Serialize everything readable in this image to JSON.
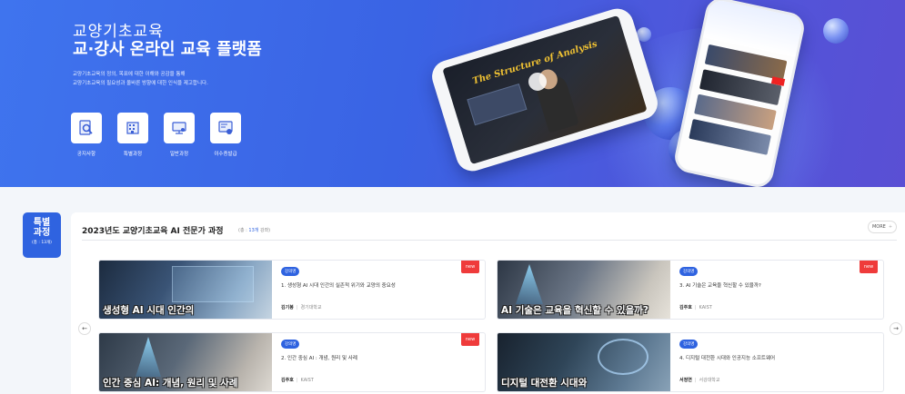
{
  "hero": {
    "title_line1": "교양기초교육",
    "title_line2": "교·강사 온라인 교육 플랫폼",
    "desc_line1": "교양기초교육의 정의, 목표에 대한 이해와 공감을 통해",
    "desc_line2": "교양기초교육의 필요성과 올바른 방향에 대한 인식을 제고합니다.",
    "tablet_screen_title": "The Structure of Analysis",
    "quick_menu": [
      {
        "label": "공지사항",
        "icon": "magnifier-document-icon"
      },
      {
        "label": "특별과정",
        "icon": "building-icon"
      },
      {
        "label": "일반과정",
        "icon": "monitor-person-icon"
      },
      {
        "label": "이수증발급",
        "icon": "certificate-icon"
      }
    ]
  },
  "section": {
    "side_badge_line1": "특별",
    "side_badge_line2": "과정",
    "side_badge_count": "(총 : 13개)",
    "title": "2023년도 교양기초교육 AI 전문가 과정",
    "subtitle_prefix": "(총 : ",
    "subtitle_count": "13개",
    "subtitle_suffix": " 강좌)",
    "more_label": "MORE",
    "more_icon": "plus-icon",
    "prev_icon": "arrow-left-icon",
    "next_icon": "arrow-right-icon"
  },
  "courses": [
    {
      "tag": "강의명",
      "title": "1. 생성형 AI 시대 인간의 실존적 위기와 교양의 중요성",
      "author": "김기봉",
      "affiliation": "경기대학교",
      "thumb_label": "생성형 AI 시대 인간의",
      "is_new": true,
      "new_label": "new"
    },
    {
      "tag": "강의명",
      "title": "3. AI 기술은 교육을 혁신할 수 있을까?",
      "author": "김주호",
      "affiliation": "KAIST",
      "thumb_label": "AI 기술은 교육을 혁신할 수 있을까?",
      "is_new": true,
      "new_label": "new"
    },
    {
      "tag": "강의명",
      "title": "2. 인간 중심 AI : 개념, 원리 및 사례",
      "author": "김주호",
      "affiliation": "KAIST",
      "thumb_label": "인간 중심 AI: 개념, 원리 및 사례",
      "is_new": true,
      "new_label": "new"
    },
    {
      "tag": "강의명",
      "title": "4. 디지털 대전환 시대와 인공지능 소프트웨어",
      "author": "서정연",
      "affiliation": "서강대학교",
      "thumb_label": "디지털 대전환 시대와",
      "is_new": false,
      "new_label": ""
    }
  ],
  "colors": {
    "accent": "#2f63e0",
    "new_badge": "#ef3b3b",
    "hero_start": "#3f74ee",
    "hero_end": "#5a4fd4"
  }
}
